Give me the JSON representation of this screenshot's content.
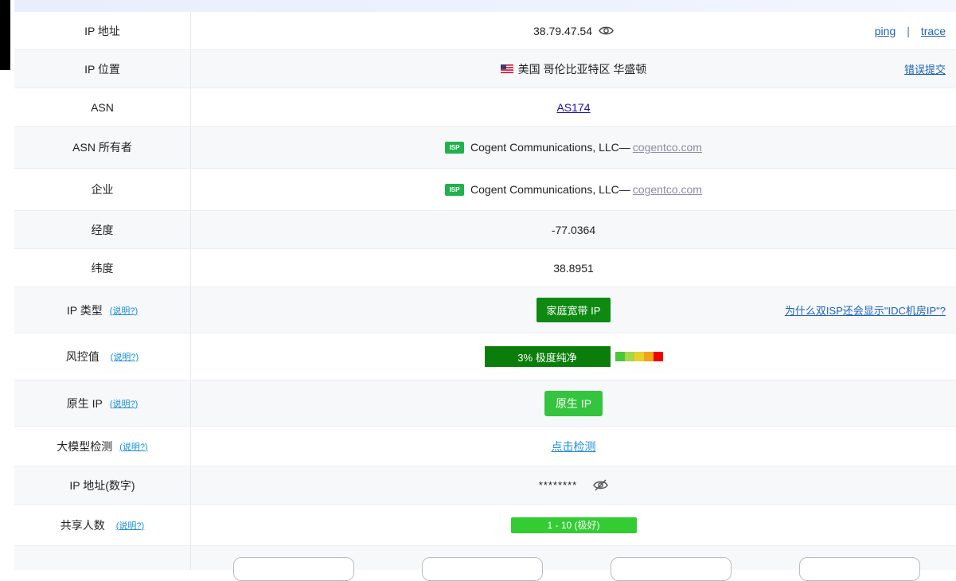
{
  "ip": {
    "label": "IP 地址",
    "value": "38.79.47.54",
    "ping": "ping",
    "separator": "|",
    "trace": "trace"
  },
  "location": {
    "label": "IP 位置",
    "flag_icon": "us-flag-icon",
    "value": "美国 哥伦比亚特区 华盛顿",
    "report": "错误提交"
  },
  "asn": {
    "label": "ASN",
    "value": "AS174"
  },
  "asn_owner": {
    "label": "ASN 所有者",
    "badge": "ISP",
    "name": "Cogent Communications, LLC—",
    "domain": "cogentco.com"
  },
  "company": {
    "label": "企业",
    "badge": "ISP",
    "name": "Cogent Communications, LLC—",
    "domain": "cogentco.com"
  },
  "longitude": {
    "label": "经度",
    "value": "-77.0364"
  },
  "latitude": {
    "label": "纬度",
    "value": "38.8951"
  },
  "ip_type": {
    "label": "IP 类型",
    "explain": "(说明?)",
    "value": "家庭宽带 IP",
    "note": "为什么双ISP还会显示\"IDC机房IP\"?"
  },
  "risk": {
    "label": "风控值",
    "explain": "(说明?)",
    "value": "3%  极度纯净",
    "level_percent": 3,
    "gauge_colors": [
      "#4dc63a",
      "#a6d64a",
      "#e6d12a",
      "#f5a21b",
      "#f00000"
    ]
  },
  "native_ip": {
    "label": "原生 IP",
    "explain": "(说明?)",
    "value": "原生 IP"
  },
  "llm_check": {
    "label": "大模型检测",
    "explain": "(说明?)",
    "action": "点击检测"
  },
  "ip_numeric": {
    "label": "IP 地址(数字)",
    "value": "********"
  },
  "shared_users": {
    "label": "共享人数",
    "explain": "(说明?)",
    "value": "1 - 10 (极好)"
  },
  "colors": {
    "accent_green_dark": "#0e8a12",
    "accent_green": "#33cc33",
    "link_blue": "#1d62b8",
    "explain_cyan": "#1a8fd6"
  }
}
